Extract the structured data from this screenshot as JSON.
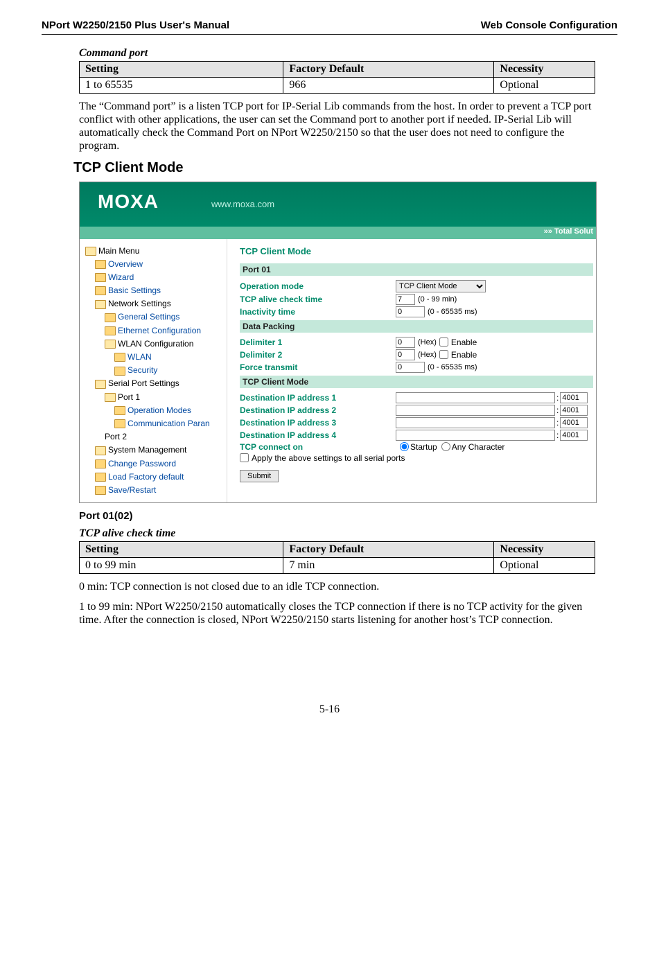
{
  "header": {
    "left": "NPort W2250/2150 Plus User's Manual",
    "right": "Web Console Configuration"
  },
  "table1": {
    "caption": "Command port",
    "h1": "Setting",
    "h2": "Factory Default",
    "h3": "Necessity",
    "r1c1": "1 to 65535",
    "r1c2": "966",
    "r1c3": "Optional"
  },
  "para1": "The “Command port” is a listen TCP port for IP-Serial Lib commands from the host. In order to prevent a TCP port conflict with other applications, the user can set the Command port to another port if needed. IP-Serial Lib will automatically check the Command Port on NPort W2250/2150 so that the user does not need to configure the program.",
  "section_title": "TCP Client Mode",
  "screenshot": {
    "logo_main": "MOXA",
    "logo_url": "www.moxa.com",
    "strip": "»»  Total Solut",
    "tree": {
      "root": "Main Menu",
      "items": [
        "Overview",
        "Wizard",
        "Basic Settings",
        "Network Settings",
        "General Settings",
        "Ethernet Configuration",
        "WLAN Configuration",
        "WLAN",
        "Security",
        "Serial Port Settings",
        "Port 1",
        "Operation Modes",
        "Communication Paran",
        "Port 2",
        "System Management",
        "Change Password",
        "Load Factory default",
        "Save/Restart"
      ]
    },
    "main": {
      "title": "TCP Client Mode",
      "band_port": "Port 01",
      "op_mode_label": "Operation mode",
      "op_mode_value": "TCP Client Mode",
      "alive_label": "TCP alive check time",
      "alive_value": "7",
      "alive_hint": "(0 - 99 min)",
      "inact_label": "Inactivity time",
      "inact_value": "0",
      "inact_hint": "(0 - 65535 ms)",
      "band_pack": "Data Packing",
      "d1_label": "Delimiter 1",
      "d1_value": "0",
      "hex_hint": "(Hex)",
      "enable_label": "Enable",
      "d2_label": "Delimiter 2",
      "d2_value": "0",
      "ft_label": "Force transmit",
      "ft_value": "0",
      "ft_hint": "(0 - 65535 ms)",
      "band_client": "TCP Client Mode",
      "dest_labels": [
        "Destination IP address 1",
        "Destination IP address 2",
        "Destination IP address 3",
        "Destination IP address 4"
      ],
      "dest_ports": [
        "4001",
        "4001",
        "4001",
        "4001"
      ],
      "conn_label": "TCP connect on",
      "conn_opt1": "Startup",
      "conn_opt2": "Any Character",
      "apply_label": "Apply the above settings to all serial ports",
      "submit": "Submit"
    }
  },
  "sub_heading": "Port 01(02)",
  "table2": {
    "caption": "TCP alive check time",
    "h1": "Setting",
    "h2": "Factory Default",
    "h3": "Necessity",
    "r1c1": "0 to 99 min",
    "r1c2": "7 min",
    "r1c3": "Optional"
  },
  "para2": "0 min: TCP connection is not closed due to an idle TCP connection.",
  "para3": "1 to 99 min: NPort W2250/2150 automatically closes the TCP connection if there is no TCP activity for the given time. After the connection is closed, NPort W2250/2150 starts listening for another host’s TCP connection.",
  "footer": "5-16"
}
